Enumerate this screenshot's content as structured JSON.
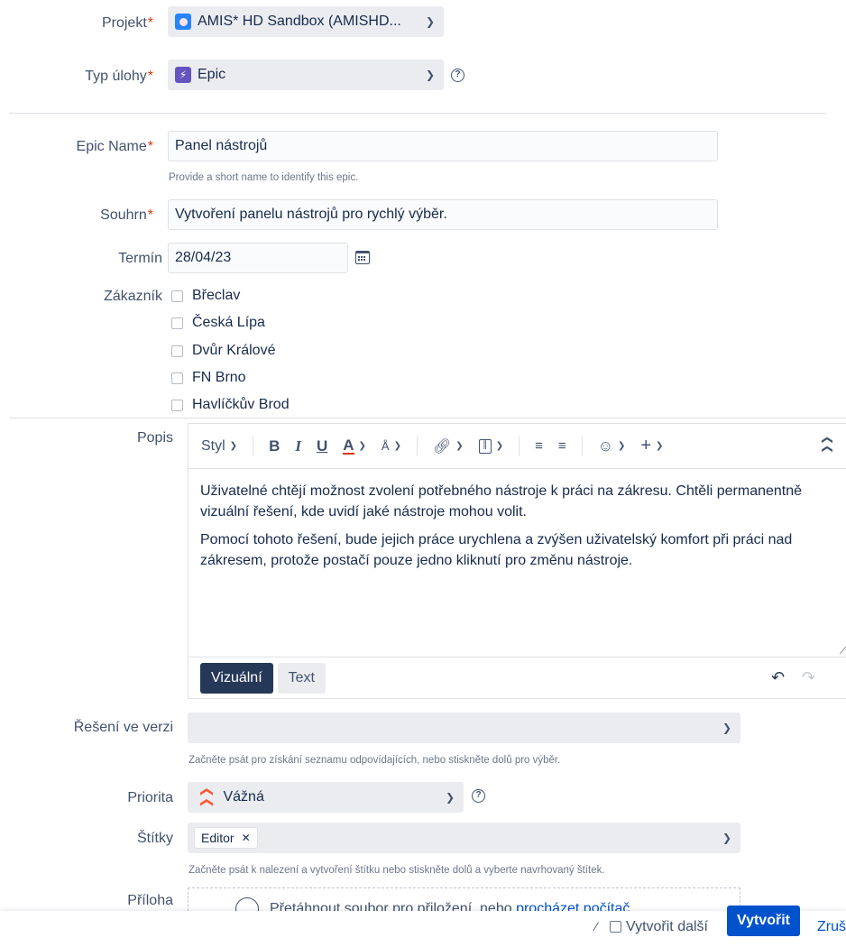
{
  "fields": {
    "project": {
      "label": "Projekt",
      "value": "AMIS* HD Sandbox (AMISHD..."
    },
    "issue_type": {
      "label": "Typ úlohy",
      "value": "Epic"
    },
    "epic_name": {
      "label": "Epic Name",
      "value": "Panel nástrojů",
      "hint": "Provide a short name to identify this epic."
    },
    "summary": {
      "label": "Souhrn",
      "value": "Vytvoření panelu nástrojů pro rychlý výběr."
    },
    "due_date": {
      "label": "Termín",
      "value": "28/04/23"
    },
    "customer": {
      "label": "Zákazník",
      "options": [
        "Břeclav",
        "Česká Lípa",
        "Dvůr Králové",
        "FN Brno",
        "Havlíčkův Brod"
      ]
    },
    "description": {
      "label": "Popis",
      "toolbar": {
        "style_label": "Styl"
      },
      "paragraphs": [
        "Uživatelné chtějí možnost zvolení potřebného nástroje k práci na zákresu. Chtěli permanentně vizuální řešení, kde uvidí jaké nástroje mohou volit.",
        "Pomocí tohoto řešení, bude jejich práce urychlena a zvýšen uživatelský komfort při práci nad zákresem, protože postačí pouze jedno kliknutí pro změnu nástroje."
      ],
      "mode_visual": "Vizuální",
      "mode_text": "Text"
    },
    "fix_version": {
      "label": "Řešení ve verzi",
      "value": "",
      "hint": "Začněte psát pro získání seznamu odpovídajících, nebo stiskněte dolů pro výběr."
    },
    "priority": {
      "label": "Priorita",
      "value": "Vážná"
    },
    "labels": {
      "label": "Štítky",
      "tags": [
        "Editor"
      ],
      "hint": "Začněte psát k nalezení a vytvoření štítku nebo stiskněte dolů a vyberte navrhovaný štítek."
    },
    "attachment": {
      "label": "Příloha",
      "drop_text": "Přetáhnout soubor pro přiložení, nebo ",
      "browse_link": "procházet počítač"
    }
  },
  "footer": {
    "create_another": "Vytvořit další",
    "create_button": "Vytvořit",
    "cancel_link": "Zruš"
  },
  "colors": {
    "primary": "#0052cc",
    "required": "#de350b",
    "epic": "#6554c0",
    "priority": "#ff5630"
  }
}
